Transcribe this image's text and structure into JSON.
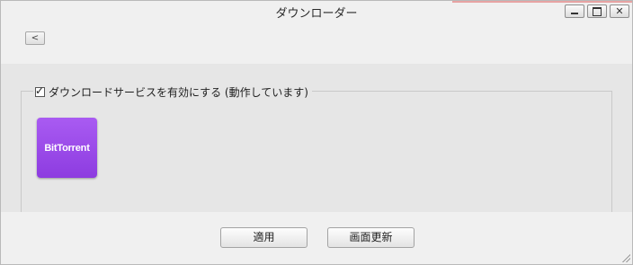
{
  "window": {
    "title": "ダウンローダー",
    "controls": {
      "minimize": "minimize",
      "maximize": "maximize",
      "close": "✕"
    }
  },
  "toolbar": {
    "back_label": "<"
  },
  "service_group": {
    "checkbox_checked": true,
    "label": "ダウンロードサービスを有効にする (動作しています)"
  },
  "services": [
    {
      "name": "BitTorrent",
      "color": "#9b4ae9"
    }
  ],
  "footer": {
    "apply_label": "適用",
    "refresh_label": "画面更新"
  }
}
